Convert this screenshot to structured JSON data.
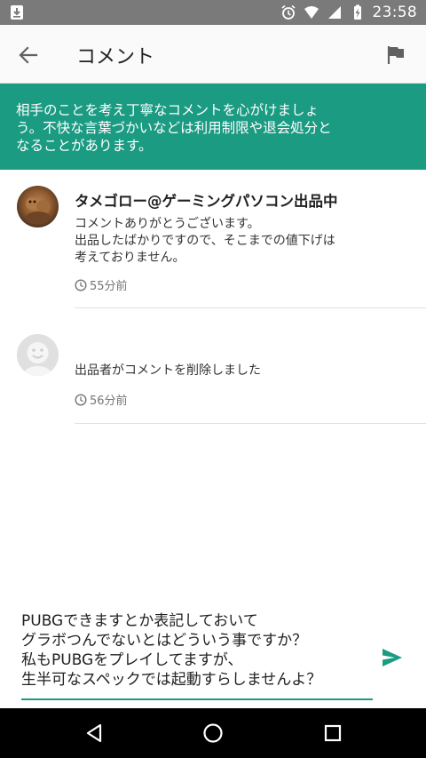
{
  "status_bar": {
    "time": "23:58",
    "icons": [
      "download-icon",
      "alarm-icon",
      "wifi-icon",
      "signal-icon",
      "battery-charging-icon"
    ]
  },
  "app_bar": {
    "title": "コメント",
    "back_icon": "arrow-back-icon",
    "flag_icon": "flag-icon"
  },
  "notice": {
    "lines": [
      "相手のことを考え丁寧なコメントを心がけましょ",
      "う。不快な言葉づかいなどは利用制限や退会処分と",
      "なることがあります。"
    ],
    "background": "#1a9b82"
  },
  "comments": [
    {
      "username": "タメゴロー@ゲーミングパソコン出品中",
      "lines": [
        "コメントありがとうございます。",
        "出品したばかりですので、そこまでの値下げは",
        "考えておりません。"
      ],
      "time": "55分前"
    },
    {
      "username": "",
      "lines": [
        "出品者がコメントを削除しました"
      ],
      "time": "56分前"
    }
  ],
  "composer": {
    "lines": [
      "PUBGできますとか表記しておいて",
      "グラボつんでないとはどういう事ですか？",
      "私もPUBGをプレイしてますが、",
      "生半可なスペックでは起動すらしませんよ？"
    ],
    "accent": "#1a9b82",
    "send_icon": "send-icon"
  },
  "nav_bar": {
    "buttons": [
      "back-triangle-icon",
      "home-circle-icon",
      "recents-square-icon"
    ]
  }
}
